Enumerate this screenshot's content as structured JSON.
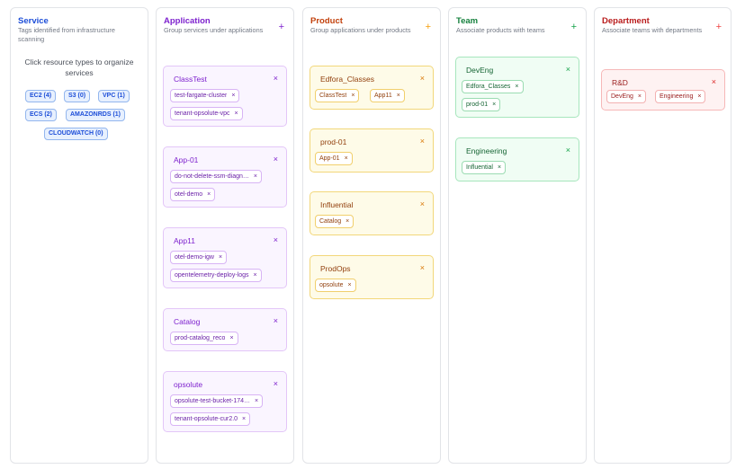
{
  "service": {
    "title": "Service",
    "subtitle": "Tags identified from infrastructure scanning",
    "hint": "Click resource types to organize services",
    "resources": [
      "EC2 (4)",
      "S3 (0)",
      "VPC (1)",
      "ECS (2)",
      "AMAZONRDS (1)",
      "CLOUDWATCH (0)"
    ]
  },
  "application": {
    "title": "Application",
    "subtitle": "Group services under applications",
    "add_icon": "+",
    "groups": [
      {
        "name": "ClassTest",
        "items": [
          "test-fargate-cluster",
          "tenant-opsolute-vpc"
        ]
      },
      {
        "name": "App-01",
        "items": [
          "do-not-delete-ssm-diagn…",
          "otel-demo"
        ]
      },
      {
        "name": "App11",
        "items": [
          "otel-demo-igw",
          "opentelemetry-deploy-logs"
        ]
      },
      {
        "name": "Catalog",
        "items": [
          "prod-catalog_reco"
        ]
      },
      {
        "name": "opsolute",
        "items": [
          "opsolute-test-bucket-174…",
          "tenant-opsolute-cur2.0"
        ]
      }
    ]
  },
  "product": {
    "title": "Product",
    "subtitle": "Group applications under products",
    "add_icon": "+",
    "groups": [
      {
        "name": "Edfora_Classes",
        "items": [
          "ClassTest",
          "App11"
        ]
      },
      {
        "name": "prod-01",
        "items": [
          "App-01"
        ]
      },
      {
        "name": "Influential",
        "items": [
          "Catalog"
        ]
      },
      {
        "name": "ProdOps",
        "items": [
          "opsolute"
        ]
      }
    ]
  },
  "team": {
    "title": "Team",
    "subtitle": "Associate products with teams",
    "add_icon": "+",
    "groups": [
      {
        "name": "DevEng",
        "items": [
          "Edfora_Classes",
          "prod-01"
        ]
      },
      {
        "name": "Engineering",
        "items": [
          "Influential"
        ]
      }
    ]
  },
  "department": {
    "title": "Department",
    "subtitle": "Associate teams with departments",
    "add_icon": "+",
    "groups": [
      {
        "name": "R&D",
        "items": [
          "DevEng",
          "Engineering"
        ]
      }
    ]
  },
  "icons": {
    "remove": "×",
    "add": "plus-icon",
    "remove_name": "close-icon"
  }
}
